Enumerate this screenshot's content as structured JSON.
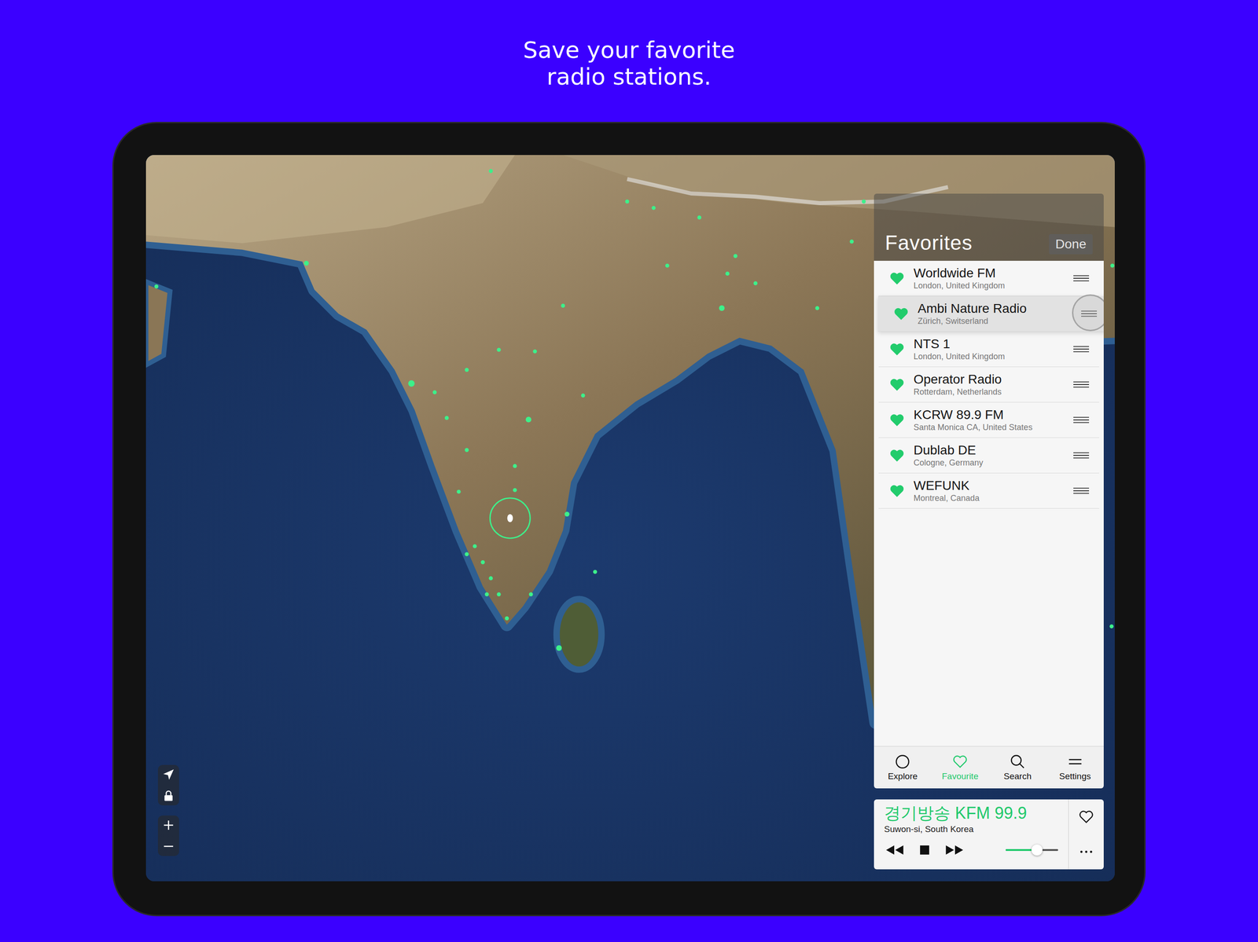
{
  "headline": [
    "Save your favorite",
    "radio stations."
  ],
  "favorites": {
    "title": "Favorites",
    "done": "Done",
    "items": [
      {
        "name": "Worldwide FM",
        "location": "London, United Kingdom",
        "dragging": false
      },
      {
        "name": "Ambi Nature Radio",
        "location": "Zürich, Switserland",
        "dragging": true
      },
      {
        "name": "NTS 1",
        "location": "London, United Kingdom",
        "dragging": false
      },
      {
        "name": "Operator Radio",
        "location": "Rotterdam, Netherlands",
        "dragging": false
      },
      {
        "name": "KCRW 89.9 FM",
        "location": "Santa Monica CA, United States",
        "dragging": false
      },
      {
        "name": "Dublab DE",
        "location": "Cologne, Germany",
        "dragging": false
      },
      {
        "name": "WEFUNK",
        "location": "Montreal, Canada",
        "dragging": false
      }
    ]
  },
  "tabs": [
    {
      "label": "Explore",
      "selected": false
    },
    {
      "label": "Favourite",
      "selected": true
    },
    {
      "label": "Search",
      "selected": false
    },
    {
      "label": "Settings",
      "selected": false
    }
  ],
  "player": {
    "station": "경기방송 KFM 99.9",
    "location": "Suwon-si, South Korea",
    "playing": true,
    "favorite": false,
    "volume": 0.6
  }
}
